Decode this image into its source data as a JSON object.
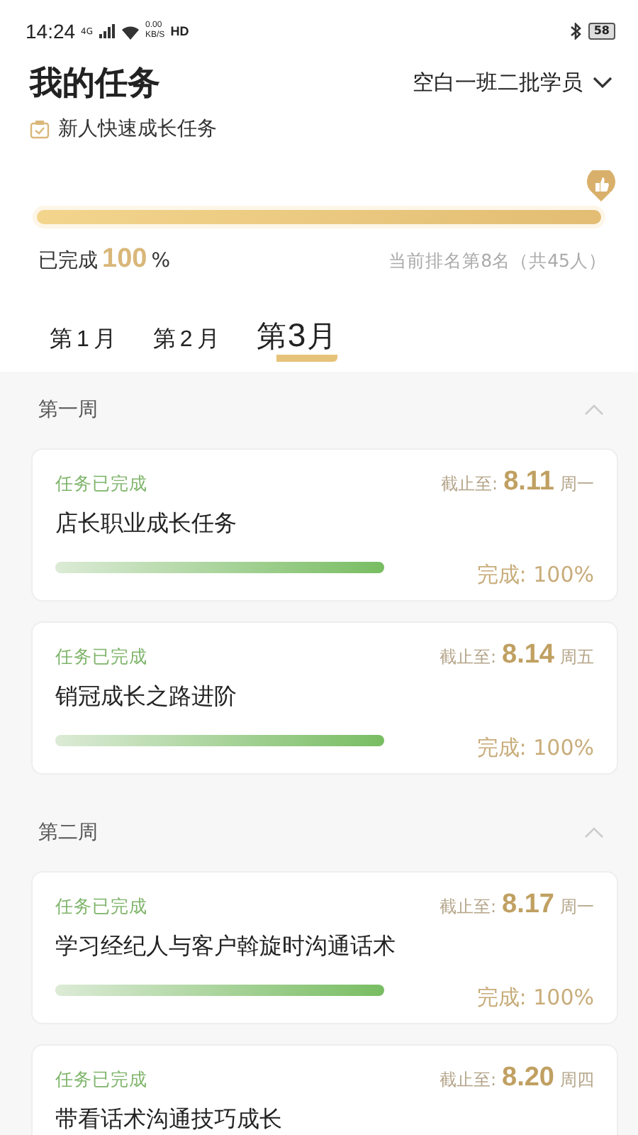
{
  "status_bar": {
    "time": "14:24",
    "network": "4G",
    "speed": "0.00",
    "speed_unit": "KB/S",
    "hd": "HD",
    "battery": "58"
  },
  "header": {
    "title": "我的任务",
    "class_selector": "空白一班二批学员"
  },
  "plan": {
    "name": "新人快速成长任务",
    "level": 1,
    "completed_label": "已完成",
    "completed_value": "100",
    "completed_unit": "%",
    "rank": "当前排名第8名（共45人）"
  },
  "tabs": [
    {
      "label": "第",
      "number": "1",
      "suffix": "月",
      "selected": false
    },
    {
      "label": "第",
      "number": "2",
      "suffix": "月",
      "selected": false
    },
    {
      "label": "第",
      "number": "3",
      "suffix": "月",
      "selected": true
    }
  ],
  "weeks": [
    {
      "title": "第一周",
      "expanded": true,
      "tasks": [
        {
          "status": "任务已完成",
          "deadline_label": "截止至:",
          "date": "8.11",
          "weekday": "周一",
          "title": "店长职业成长任务",
          "level": 1,
          "percent": "完成: 100%"
        },
        {
          "status": "任务已完成",
          "deadline_label": "截止至:",
          "date": "8.14",
          "weekday": "周五",
          "title": "销冠成长之路进阶",
          "level": 1,
          "percent": "完成: 100%"
        }
      ]
    },
    {
      "title": "第二周",
      "expanded": true,
      "tasks": [
        {
          "status": "任务已完成",
          "deadline_label": "截止至:",
          "date": "8.17",
          "weekday": "周一",
          "title": "学习经纪人与客户斡旋时沟通话术",
          "level": 1,
          "percent": "完成: 100%"
        },
        {
          "status": "任务已完成",
          "deadline_label": "截止至:",
          "date": "8.20",
          "weekday": "周四",
          "title": "带看话术沟通技巧成长"
        }
      ]
    }
  ]
}
